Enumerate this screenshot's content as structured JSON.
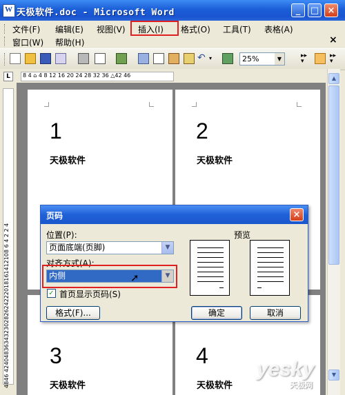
{
  "window": {
    "title": "天极软件.doc - Microsoft Word"
  },
  "menu": {
    "row1": [
      "文件(F)",
      "编辑(E)",
      "视图(V)",
      "插入(I)",
      "格式(O)",
      "工具(T)",
      "表格(A)"
    ],
    "row2": [
      "窗口(W)",
      "帮助(H)"
    ],
    "highlighted": "插入(I)",
    "close_glyph": "×"
  },
  "toolbar": {
    "zoom": "25%"
  },
  "ruler": {
    "corner": "L",
    "horizontal": "8 4 ⌂ 4 8 12 16 20 24 28 32 36 △42 46",
    "vertical": "4846 42404836343230282624222018161412108 6 4 2 2 4"
  },
  "pages": [
    {
      "number": "1",
      "text": "天极软件"
    },
    {
      "number": "2",
      "text": "天极软件"
    },
    {
      "number": "3",
      "text": "天极软件"
    },
    {
      "number": "4",
      "text": "天极软件"
    }
  ],
  "dialog": {
    "title": "页码",
    "position_label": "位置(P):",
    "position_value": "页面底端(页脚)",
    "alignment_label": "对齐方式(A):",
    "alignment_value": "内侧",
    "first_page_label": "首页显示页码(S)",
    "first_page_checked": true,
    "preview_label": "预览",
    "format_button": "格式(F)...",
    "ok_button": "确定",
    "cancel_button": "取消"
  },
  "watermark": {
    "brand": "yesky",
    "sub": "天极网"
  },
  "colors": {
    "title_blue": "#1b5ed6",
    "highlight_red": "#e02020",
    "selection": "#316ac5"
  }
}
